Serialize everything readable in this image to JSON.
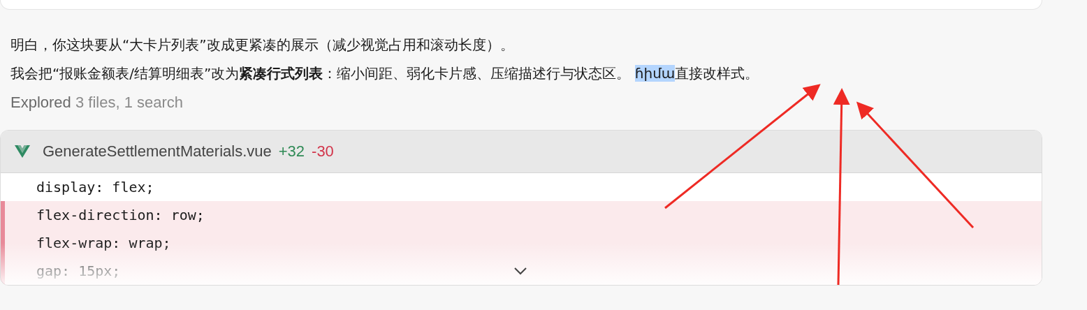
{
  "message": {
    "lines": [
      {
        "segments": [
          {
            "text": "明白，你这块要从“大卡片列表”改成更紧凑的展示（减少视觉占用和滚动长度）。",
            "selected": false
          }
        ]
      },
      {
        "segments": [
          {
            "text": "我会把“报账金额表/结算明细表”改为**紧凑行式列表**：缩小间距、弱化卡片感、压缩描述行与状态区。 ",
            "selected": false
          },
          {
            "text": "ɦիմա",
            "selected": true
          },
          {
            "text": "直接改样式。",
            "selected": false
          }
        ]
      }
    ]
  },
  "explored": {
    "label": "Explored",
    "detail": "3 files, 1 search"
  },
  "diff": {
    "filename": "GenerateSettlementMaterials.vue",
    "added": "+32",
    "removed": "-30",
    "expanded": false,
    "lines": [
      {
        "kind": "context",
        "code": "display: flex;"
      },
      {
        "kind": "removed",
        "code": "flex-direction: row;"
      },
      {
        "kind": "removed",
        "code": "flex-wrap: wrap;"
      },
      {
        "kind": "removed",
        "code": "gap: 15px;"
      }
    ]
  }
}
